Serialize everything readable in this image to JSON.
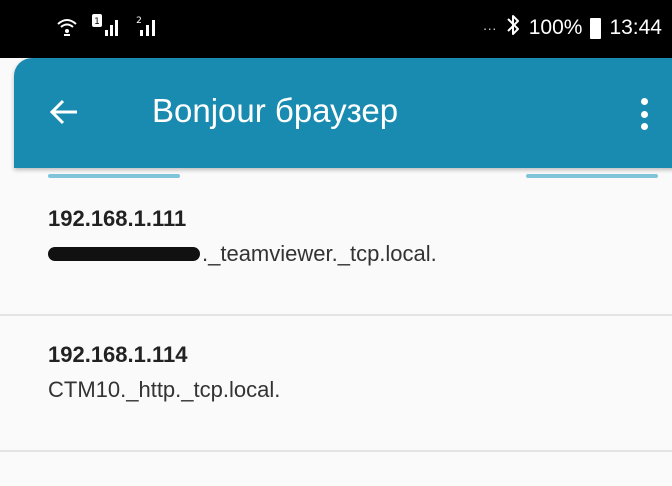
{
  "status_bar": {
    "left_icons": [
      "wifi-calling-icon",
      "signal-sim1-icon",
      "signal-sim2-icon"
    ],
    "more_indicator": "···",
    "bluetooth_icon": "bluetooth-icon",
    "battery_percent": "100%",
    "time": "13:44"
  },
  "app_bar": {
    "title": "Bonjour браузер",
    "color": "#1a8bb0"
  },
  "services": [
    {
      "ip": "192.168.1.111",
      "name_suffix": "._teamviewer._tcp.local.",
      "name_redacted": true
    },
    {
      "ip": "192.168.1.114",
      "name": "CTM10._http._tcp.local."
    }
  ]
}
